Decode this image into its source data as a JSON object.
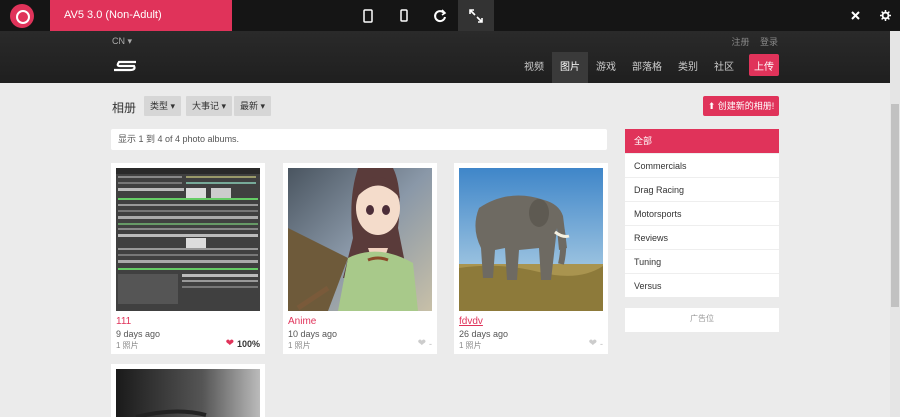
{
  "demo": {
    "title": "AV5 3.0 (Non-Adult)",
    "device_icons": [
      "tablet-icon",
      "phone-icon",
      "refresh-icon",
      "expand-icon"
    ],
    "right_icons": [
      "close-icon",
      "gear-icon"
    ]
  },
  "header": {
    "lang": "CN ▾",
    "top_links": [
      "注册",
      "登录"
    ],
    "nav": [
      {
        "label": "视频",
        "active": false
      },
      {
        "label": "图片",
        "active": true
      },
      {
        "label": "游戏",
        "active": false
      },
      {
        "label": "部落格",
        "active": false
      },
      {
        "label": "类别",
        "active": false
      },
      {
        "label": "社区",
        "active": false
      }
    ],
    "upload_label": "上传"
  },
  "toolbar": {
    "title": "相册",
    "filters": [
      "类型 ▾",
      "大事记 ▾",
      "最新 ▾"
    ],
    "create_label": "创建新的相册!"
  },
  "count_text": "显示 1 到 4 of 4 photo albums.",
  "albums": [
    {
      "title": "111",
      "date": "9 days ago",
      "photos": "1 照片",
      "likes": "100%",
      "liked": true
    },
    {
      "title": "Anime",
      "date": "10 days ago",
      "photos": "1 照片",
      "likes": "-",
      "liked": false
    },
    {
      "title": "fdvdv",
      "date": "26 days ago",
      "photos": "1 照片",
      "likes": "-",
      "liked": false
    },
    {
      "title": "",
      "date": "",
      "photos": "",
      "likes": "",
      "liked": false
    }
  ],
  "categories": [
    {
      "label": "全部",
      "active": true
    },
    {
      "label": "Commercials",
      "active": false
    },
    {
      "label": "Drag Racing",
      "active": false
    },
    {
      "label": "Motorsports",
      "active": false
    },
    {
      "label": "Reviews",
      "active": false
    },
    {
      "label": "Tuning",
      "active": false
    },
    {
      "label": "Versus",
      "active": false
    }
  ],
  "sidebar_box_text": "广告位",
  "colors": {
    "accent": "#e0335a",
    "dark": "#151515"
  }
}
